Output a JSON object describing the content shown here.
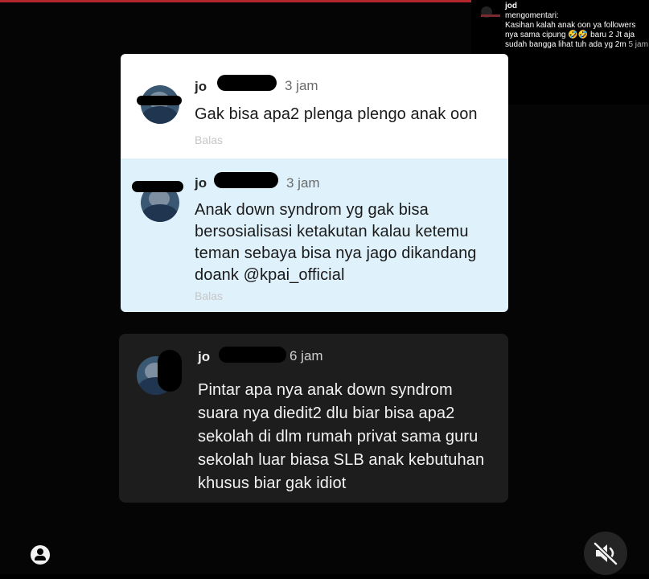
{
  "overlay_comment": {
    "username": "jod",
    "action": "mengomentari:",
    "text": "Kasihan kalah anak oon ya followers nya sama cipung",
    "emoji": "🤣🤣",
    "text2": "baru 2 Jt aja sudah bangga lihat tuh ada yg 2m",
    "time": "5 jam"
  },
  "comments": [
    {
      "username": "jo",
      "time": "3 jam",
      "text": "Gak bisa apa2 plenga plengo anak oon",
      "reply_label": "Balas"
    },
    {
      "username": "jo",
      "time": "3 jam",
      "lines": [
        "Anak down syndrom yg gak bisa",
        "bersosialisasi ketakutan kalau ketemu",
        "teman sebaya bisa nya jago dikandang",
        "doank @kpai_official"
      ],
      "reply_label": "Balas"
    },
    {
      "username": "jo",
      "time": "6 jam",
      "lines": [
        "Pintar apa nya anak down syndrom",
        "suara nya diedit2 dlu biar bisa apa2",
        "sekolah di dlm rumah privat sama guru",
        "sekolah luar biasa SLB anak kebutuhan",
        "khusus biar gak idiot"
      ]
    }
  ],
  "icons": {
    "profile": "profile-icon",
    "mute": "speaker-muted-icon"
  },
  "colors": {
    "card_white": "#ffffff",
    "card_highlight": "#dff1fb",
    "card_dark": "#1d1d1d",
    "top_bar": "#b3262e"
  }
}
